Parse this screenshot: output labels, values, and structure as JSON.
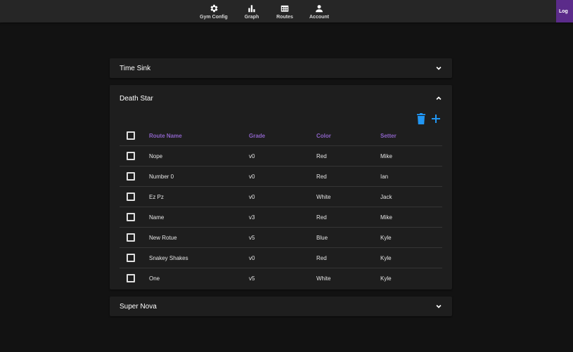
{
  "nav": {
    "items": [
      {
        "label": "Gym Config",
        "icon": "gear-icon"
      },
      {
        "label": "Graph",
        "icon": "bar-chart-icon"
      },
      {
        "label": "Routes",
        "icon": "routes-icon"
      },
      {
        "label": "Account",
        "icon": "person-icon"
      }
    ],
    "login_label": "Log"
  },
  "panels": {
    "time_sink": {
      "title": "Time Sink",
      "expanded": false
    },
    "death_star": {
      "title": "Death Star",
      "expanded": true,
      "columns": [
        "Route Name",
        "Grade",
        "Color",
        "Setter"
      ],
      "rows": [
        {
          "name": "Nope",
          "grade": "v0",
          "color": "Red",
          "setter": "Mike"
        },
        {
          "name": "Number 0",
          "grade": "v0",
          "color": "Red",
          "setter": "Ian"
        },
        {
          "name": "Ez Pz",
          "grade": "v0",
          "color": "White",
          "setter": "Jack"
        },
        {
          "name": "Name",
          "grade": "v3",
          "color": "Red",
          "setter": "Mike"
        },
        {
          "name": "New Rotue",
          "grade": "v5",
          "color": "Blue",
          "setter": "Kyle"
        },
        {
          "name": "Snakey Shakes",
          "grade": "v0",
          "color": "Red",
          "setter": "Kyle"
        },
        {
          "name": "One",
          "grade": "v5",
          "color": "White",
          "setter": "Kyle"
        }
      ]
    },
    "super_nova": {
      "title": "Super Nova",
      "expanded": false
    }
  },
  "colors": {
    "accent_purple": "#8d63c7",
    "action_blue": "#2196f3",
    "login_bg": "#5b2b8a"
  }
}
